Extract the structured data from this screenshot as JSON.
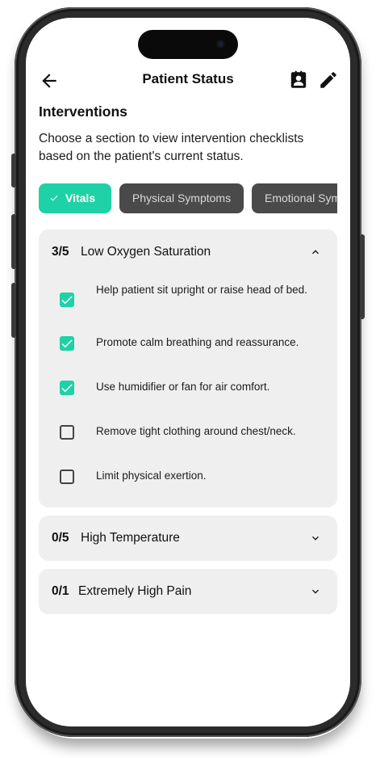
{
  "header": {
    "title": "Patient Status",
    "back_icon": "arrow-left-icon",
    "contact_icon": "contact-card-icon",
    "edit_icon": "pencil-icon"
  },
  "section": {
    "title": "Interventions",
    "description": "Choose a section to view intervention checklists based on the patient's current status."
  },
  "tabs": [
    {
      "label": "Vitals",
      "active": true
    },
    {
      "label": "Physical Symptoms",
      "active": false
    },
    {
      "label": "Emotional Symptoms",
      "active": false
    }
  ],
  "accordions": [
    {
      "count": "3/5",
      "title": "Low Oxygen Saturation",
      "expanded": true,
      "items": [
        {
          "label": "Help patient sit upright or raise head of bed.",
          "checked": true
        },
        {
          "label": "Promote calm breathing and reassurance.",
          "checked": true
        },
        {
          "label": "Use humidifier or fan for air comfort.",
          "checked": true
        },
        {
          "label": "Remove tight clothing around chest/neck.",
          "checked": false
        },
        {
          "label": "Limit physical exertion.",
          "checked": false
        }
      ]
    },
    {
      "count": "0/5",
      "title": "High Temperature",
      "expanded": false
    },
    {
      "count": "0/1",
      "title": "Extremely High Pain",
      "expanded": false
    }
  ],
  "colors": {
    "accent": "#1fd1a7",
    "chip_inactive": "#4a4a4a",
    "card_bg": "#efefef"
  }
}
